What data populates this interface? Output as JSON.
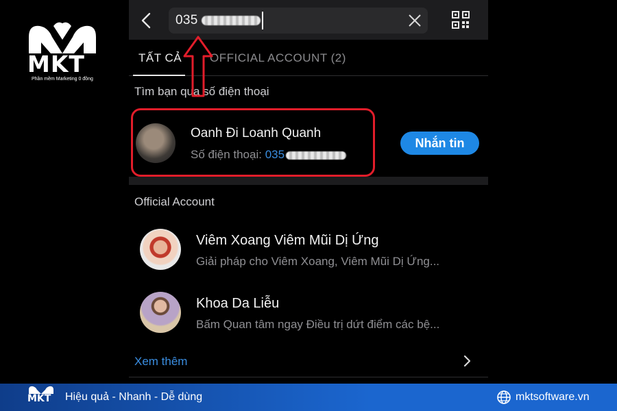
{
  "brand": {
    "logo_text": "MKT",
    "tagline": "Phần mềm Marketing 0 đồng"
  },
  "search": {
    "value": "035"
  },
  "tabs": [
    {
      "label": "TẤT CẢ",
      "active": true
    },
    {
      "label": "OFFICIAL ACCOUNT (2)",
      "active": false
    }
  ],
  "phone_section": {
    "heading": "Tìm bạn qua số điện thoại",
    "result": {
      "name": "Oanh Đi Loanh Quanh",
      "phone_label": "Số điện thoại: ",
      "phone_value": "035",
      "action_label": "Nhắn tin"
    }
  },
  "oa_section": {
    "heading": "Official Account",
    "items": [
      {
        "name": "Viêm Xoang Viêm Mũi Dị Ứng",
        "description": "Giải pháp cho Viêm Xoang, Viêm Mũi Dị Ứng..."
      },
      {
        "name": "Khoa Da Liễu",
        "description": "Bấm Quan tâm ngay Điều trị dứt điểm các bệ..."
      }
    ],
    "see_more": "Xem thêm"
  },
  "footer": {
    "logo_text": "MKT",
    "slogan": "Hiệu quả - Nhanh - Dễ dùng",
    "website": "mktsoftware.vn"
  },
  "colors": {
    "accent_blue": "#1e88e5",
    "link_blue": "#3a8de0",
    "highlight_red": "#e11d2a",
    "footer_blue": "#1b66cf"
  }
}
